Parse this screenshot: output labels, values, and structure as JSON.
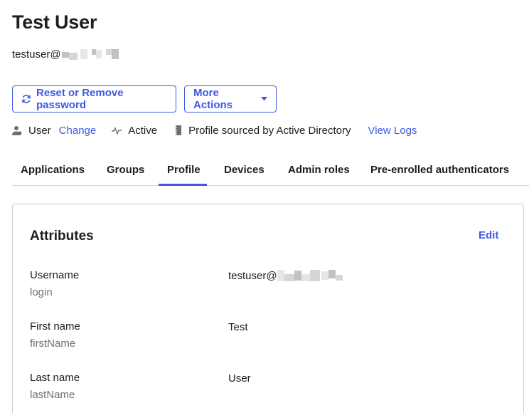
{
  "user": {
    "name": "Test User",
    "email_visible": "testuser@"
  },
  "actions": {
    "reset_label": "Reset or Remove password",
    "more_label": "More Actions"
  },
  "status": {
    "type_label": "User",
    "change_label": "Change",
    "state_label": "Active",
    "source_label": "Profile sourced by Active Directory",
    "logs_label": "View Logs"
  },
  "tabs": [
    {
      "label": "Applications"
    },
    {
      "label": "Groups"
    },
    {
      "label": "Profile"
    },
    {
      "label": "Devices"
    },
    {
      "label": "Admin roles"
    },
    {
      "label": "Pre-enrolled authenticators"
    }
  ],
  "active_tab": "Profile",
  "attributes": {
    "title": "Attributes",
    "edit_label": "Edit",
    "rows": [
      {
        "label": "Username",
        "key": "login",
        "value": "testuser@"
      },
      {
        "label": "First name",
        "key": "firstName",
        "value": "Test"
      },
      {
        "label": "Last name",
        "key": "lastName",
        "value": "User"
      }
    ]
  },
  "colors": {
    "accent": "#3f59e4",
    "text": "#1d1d21",
    "muted": "#6e6e78",
    "border": "#cfcfd4"
  },
  "icons": {
    "reset": "refresh-icon",
    "more": "caret-down-icon",
    "type": "user-icon",
    "state": "pulse-icon",
    "source": "directory-icon"
  }
}
